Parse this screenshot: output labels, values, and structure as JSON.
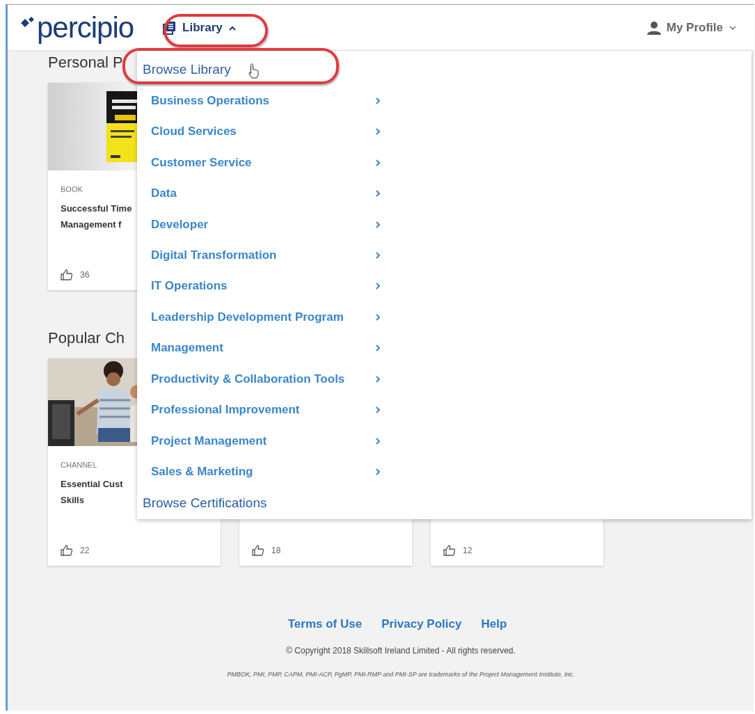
{
  "header": {
    "logo": "percipio",
    "nav": {
      "label": "Library",
      "expanded": true,
      "highlighted": true
    },
    "profile": {
      "label": "My Profile"
    }
  },
  "sections": [
    {
      "title": "Personal P",
      "cards": [
        {
          "kind": "picture",
          "type": "BOOK",
          "title": "Successful Time Management f",
          "likes": "36"
        }
      ]
    },
    {
      "title": "Popular Ch",
      "cards": [
        {
          "kind": "picture",
          "type": "CHANNEL",
          "title": "Essential Cust Skills",
          "likes": "22"
        },
        {
          "likes": "18"
        },
        {
          "likes": "12"
        }
      ]
    }
  ],
  "menu": {
    "items": [
      {
        "kind": "heading",
        "label": "Browse Library",
        "highlighted": true
      },
      {
        "kind": "category",
        "label": "Business Operations",
        "highlighted": false
      },
      {
        "kind": "category",
        "label": "Cloud Services",
        "highlighted": false
      },
      {
        "kind": "category",
        "label": "Customer Service",
        "highlighted": false
      },
      {
        "kind": "category",
        "label": "Data",
        "highlighted": false
      },
      {
        "kind": "category",
        "label": "Developer",
        "highlighted": false
      },
      {
        "kind": "category",
        "label": "Digital Transformation",
        "highlighted": false
      },
      {
        "kind": "category",
        "label": "IT Operations",
        "highlighted": false
      },
      {
        "kind": "category",
        "label": "Leadership Development Program",
        "highlighted": false
      },
      {
        "kind": "category",
        "label": "Management",
        "highlighted": false
      },
      {
        "kind": "category",
        "label": "Productivity & Collaboration Tools",
        "highlighted": false
      },
      {
        "kind": "category",
        "label": "Professional Improvement",
        "highlighted": false
      },
      {
        "kind": "category",
        "label": "Project Management",
        "highlighted": false
      },
      {
        "kind": "category",
        "label": "Sales & Marketing",
        "highlighted": false
      },
      {
        "kind": "heading",
        "label": "Browse Certifications",
        "highlighted": false
      }
    ]
  },
  "footer": {
    "links": [
      "Terms of Use",
      "Privacy Policy",
      "Help"
    ],
    "copyright": "© Copyright 2018 Skillsoft Ireland Limited - All rights reserved.",
    "trademark": "PMBOK, PMI, PMP, CAPM, PMI-ACP, PgMP, PMI-RMP and PMI-SP are trademarks of the Project Management Institute, Inc."
  }
}
